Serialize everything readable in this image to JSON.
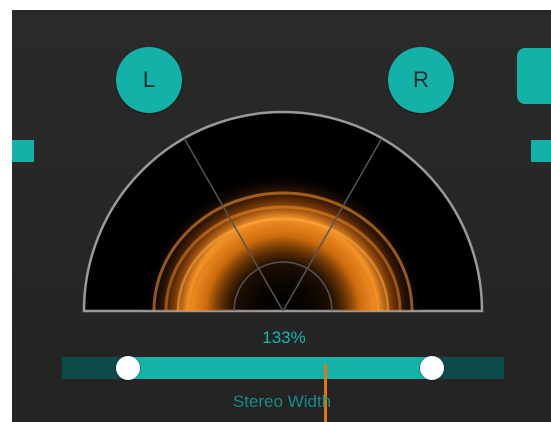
{
  "channels": {
    "left_label": "L",
    "right_label": "R"
  },
  "display": {
    "width_value": "133%"
  },
  "slider": {
    "label": "Stereo Width",
    "range_start": 0.15,
    "range_end": 0.837,
    "center_marker": 0.5
  },
  "colors": {
    "accent": "#14b1a8",
    "accent_dark": "#0d4b48",
    "glow": "#e3770e",
    "panel": "#262626"
  }
}
